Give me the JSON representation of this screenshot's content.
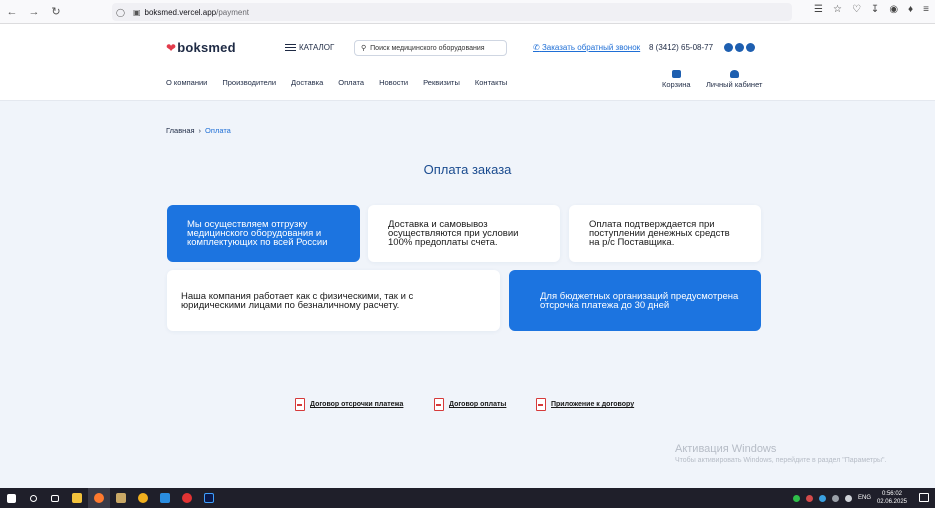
{
  "browser": {
    "url_host": "boksmed.vercel.app",
    "url_path": "/payment"
  },
  "header": {
    "logo": "boksmed",
    "catalog_label": "КАТАЛОГ",
    "search_placeholder": "Поиск медицинского оборудования",
    "callback_label": "Заказать обратный звонок",
    "phone": "8 (3412) 65-08-77",
    "menu": [
      "О компании",
      "Производители",
      "Доставка",
      "Оплата",
      "Новости",
      "Реквизиты",
      "Контакты"
    ],
    "cart_label": "Корзина",
    "cabinet_label": "Личный кабинет"
  },
  "breadcrumb": {
    "home": "Главная",
    "separator": "›",
    "current": "Оплата"
  },
  "page_title": "Оплата заказа",
  "cards": [
    "Мы осуществляем отгрузку медицинского оборудования и комплектующих по всей России",
    "Доставка и самовывоз осуществляются при условии 100% предоплаты счета.",
    "Оплата подтверждается при поступлении денежных средств на р/с Поставщика.",
    "Наша компания работает как с физическими, так и с юридическими лицами по безналичному расчету.",
    "Для бюджетных организаций предусмотрена отсрочка платежа до 30 дней"
  ],
  "documents": [
    "Договор отсрочки платежа",
    "Договор оплаты",
    "Приложение к договору"
  ],
  "watermark": {
    "title": "Активация Windows",
    "subtitle": "Чтобы активировать Windows, перейдите в раздел \"Параметры\"."
  },
  "taskbar": {
    "lang": "ENG",
    "time": "0:56:02",
    "date": "02.06.2025"
  },
  "colors": {
    "accent": "#1c74e0",
    "brand_heart": "#e23b4b",
    "title": "#1a4b8f"
  }
}
